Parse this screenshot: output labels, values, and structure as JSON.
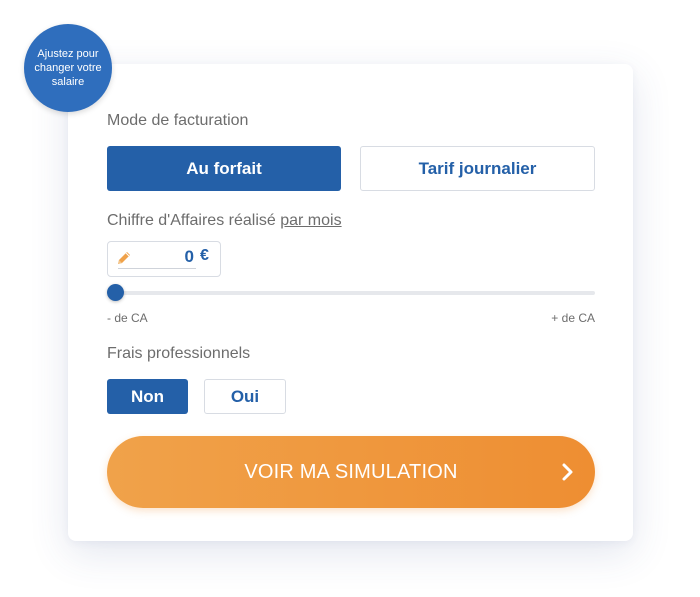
{
  "badge": {
    "text": "Ajustez pour changer votre salaire"
  },
  "billing": {
    "label": "Mode de facturation",
    "options": [
      {
        "label": "Au forfait",
        "selected": true
      },
      {
        "label": "Tarif journalier",
        "selected": false
      }
    ]
  },
  "revenue": {
    "label": "Chiffre d'Affaires réalisé",
    "period_link": "par mois",
    "value": "0",
    "currency": "€",
    "icon": "pencil-icon",
    "slider": {
      "min_label": "- de CA",
      "max_label": "+ de CA",
      "position": 0
    }
  },
  "expenses": {
    "label": "Frais professionnels",
    "options": [
      {
        "label": "Non",
        "selected": true
      },
      {
        "label": "Oui",
        "selected": false
      }
    ]
  },
  "cta": {
    "label": "VOIR MA SIMULATION",
    "icon": "chevron-right-icon"
  },
  "colors": {
    "primary": "#2460a8",
    "accent": "#ee8e32",
    "badge": "#2f6ebd",
    "text_muted": "#6d6d6d"
  }
}
